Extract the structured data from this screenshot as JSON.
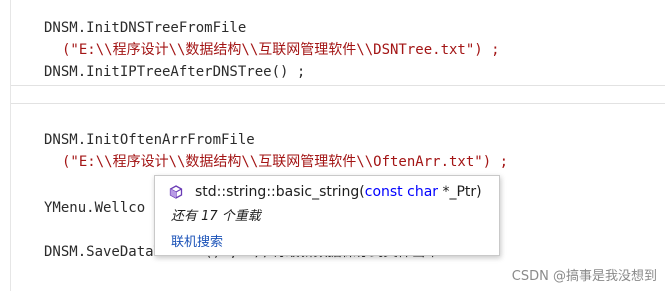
{
  "editor": {
    "lines": [
      "DNSM.InitDNSTreeFromFile",
      "(\"E:\\\\程序设计\\\\数据结构\\\\互联网管理软件\\\\DSNTree.txt\") ;",
      "DNSM.InitIPTreeAfterDNSTree() ;",
      "DNSM.InitOftenArrFromFile",
      "(\"E:\\\\程序设计\\\\数据结构\\\\互联网管理软件\\\\OftenArr.txt\") ;",
      "YMenu.Wellco",
      "DNSM.SaveDataToFile() ;  //将最新数据保存到文件当中"
    ]
  },
  "tooltip": {
    "sig_ns1": "std",
    "sig_sep1": "::",
    "sig_ns2": "string",
    "sig_sep2": "::",
    "sig_fn": "basic_string(",
    "sig_kw": "const char",
    "sig_param": " *_Ptr)",
    "overloads": "还有 17 个重载",
    "search_link": "联机搜索",
    "icon": "cube-icon"
  },
  "watermark": "CSDN @搞事是我没想到"
}
